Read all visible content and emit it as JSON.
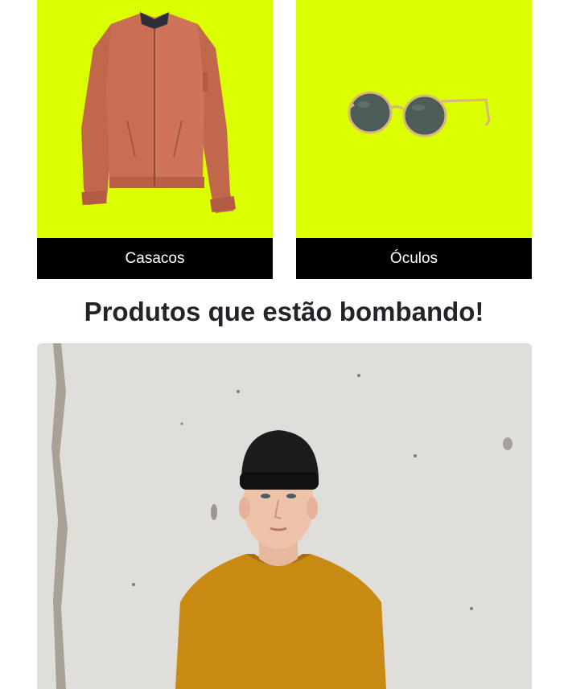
{
  "categories": [
    {
      "label": "Casacos",
      "image": "orange-bomber-jacket",
      "background": "#dbff00"
    },
    {
      "label": "Óculos",
      "image": "round-sunglasses",
      "background": "#dbff00"
    }
  ],
  "trending": {
    "title": "Produtos que estão bombando!",
    "image": "young-man-beanie-mustard-tshirt-concrete-wall"
  },
  "colors": {
    "accent": "#dbff00",
    "label_bg": "#000000",
    "label_text": "#ffffff",
    "heading": "#212529"
  }
}
